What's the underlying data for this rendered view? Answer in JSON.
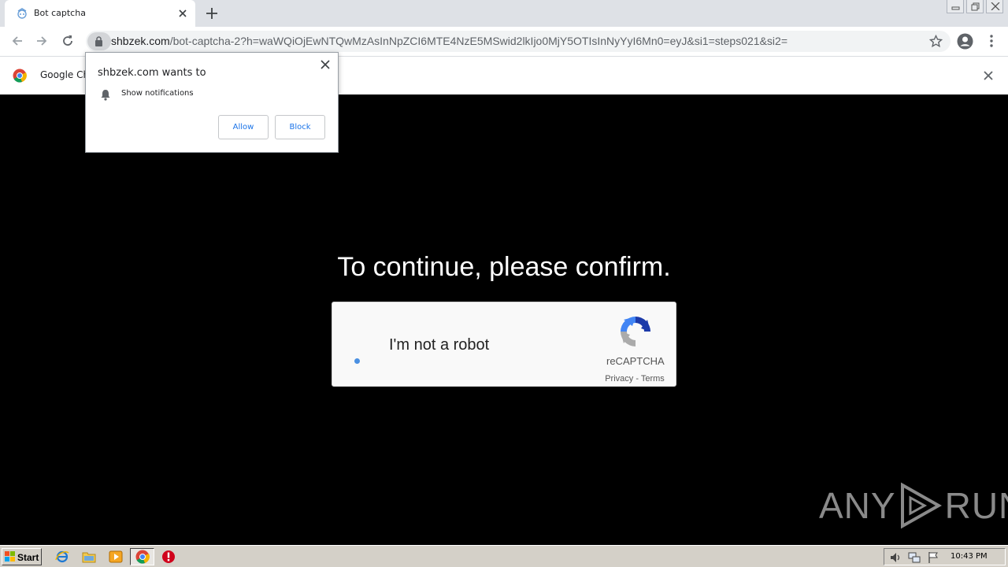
{
  "browser": {
    "tab": {
      "title": "Bot captcha",
      "favicon": "bot-captcha-favicon-icon"
    },
    "url": {
      "host": "shbzek.com",
      "path": "/bot-captcha-2?h=waWQiOjEwNTQwMzAsInNpZCI6MTE4NzE5MSwid2lkIjo0MjY5OTIsInNyYyI6Mn0=eyJ&si1=steps021&si2="
    },
    "infobar": {
      "text": "Google Ch"
    }
  },
  "notification_popup": {
    "title": "shbzek.com wants to",
    "permission": "Show notifications",
    "allow_label": "Allow",
    "block_label": "Block"
  },
  "page": {
    "headline": "To continue, please confirm.",
    "captcha": {
      "label": "I'm not a robot",
      "brand": "reCAPTCHA",
      "privacy": "Privacy",
      "separator": " - ",
      "terms": "Terms"
    },
    "watermark": {
      "left": "ANY",
      "right": "RUN"
    }
  },
  "taskbar": {
    "start_label": "Start",
    "clock": "10:43 PM"
  },
  "colors": {
    "page_background": "#000000",
    "link_blue": "#1a73e8",
    "recaptcha_blue": "#4a90e2"
  }
}
